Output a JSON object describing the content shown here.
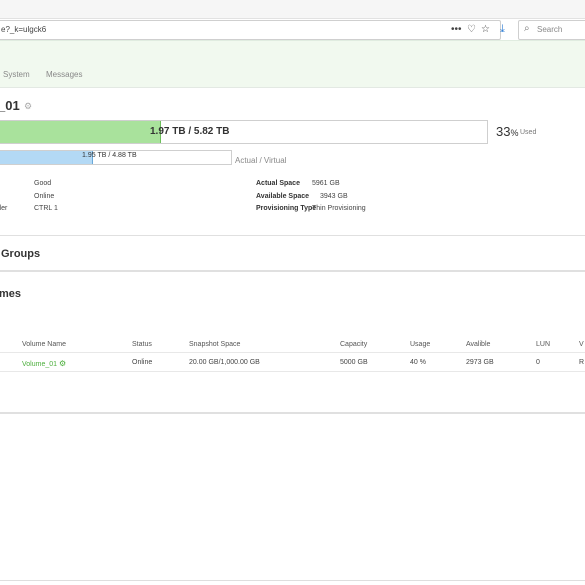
{
  "browser": {
    "url": "e?_k=ulgck6",
    "search_placeholder": "Search"
  },
  "nav": {
    "items": [
      "System",
      "Messages"
    ]
  },
  "pool": {
    "title": "_01",
    "capacity_text": "1.97 TB / 5.82 TB",
    "capacity_fraction": 0.33,
    "used_percent": "33",
    "percent_symbol": "%",
    "used_label": "Used",
    "virtual_text": "1.95 TB / 4.88 TB",
    "virtual_fraction": 0.4,
    "virtual_caption": "Actual / Virtual",
    "left_props": [
      {
        "label": "",
        "value": "Good"
      },
      {
        "label": "",
        "value": "Online"
      },
      {
        "label": "ller",
        "value": "CTRL 1"
      }
    ],
    "right_props": [
      {
        "label": "Actual Space",
        "value": "5961 GB"
      },
      {
        "label": "Available Space",
        "value": "3943 GB"
      },
      {
        "label": "Provisioning Type",
        "value": "Thin Provisioning"
      }
    ]
  },
  "sections": {
    "groups_title": "Groups",
    "volumes_title": "mes"
  },
  "table": {
    "headers": [
      "Volume Name",
      "Status",
      "Snapshot Space",
      "Capacity",
      "Usage",
      "Avalible",
      "LUN",
      "V"
    ],
    "rows": [
      [
        "Volume_01",
        "Online",
        "20.00 GB/1,000.00 GB",
        "5000 GB",
        "40 %",
        "2973 GB",
        "0",
        "R"
      ]
    ]
  }
}
